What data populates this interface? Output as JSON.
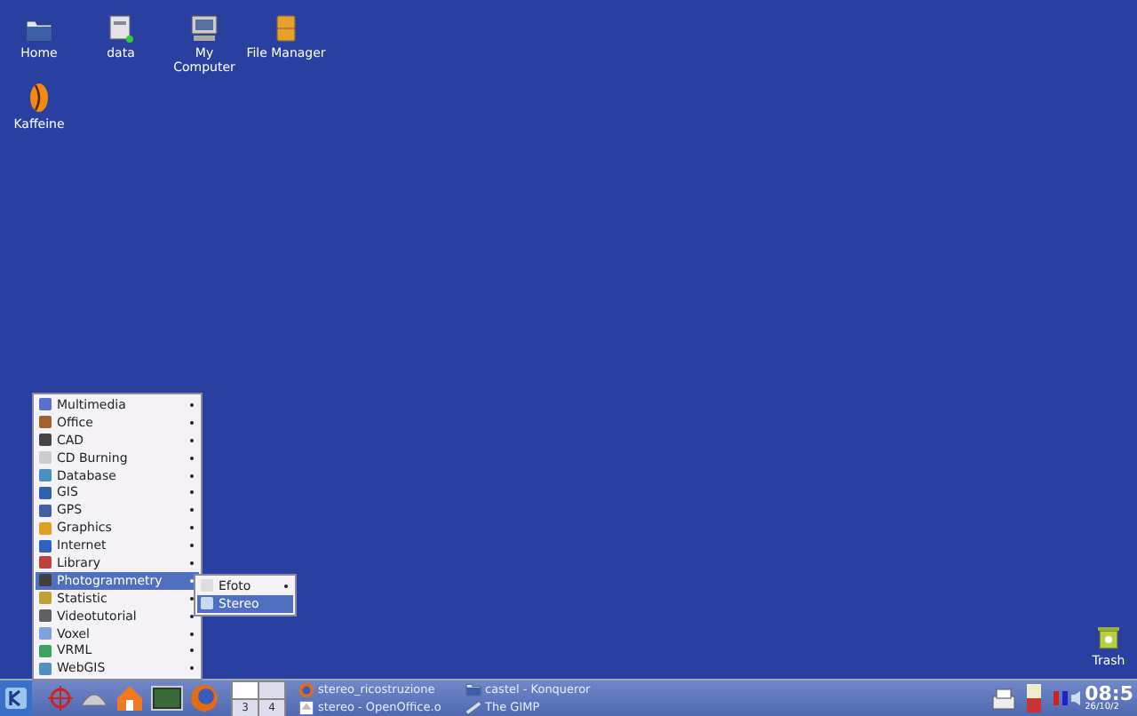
{
  "desktop_icons": [
    {
      "label": "Home",
      "kind": "folder"
    },
    {
      "label": "data",
      "kind": "drive"
    },
    {
      "label": "My Computer",
      "kind": "computer"
    },
    {
      "label": "File Manager",
      "kind": "cabinet"
    },
    {
      "label": "Kaffeine",
      "kind": "player"
    },
    {
      "label": "Trash",
      "kind": "trash"
    }
  ],
  "menu": {
    "items": [
      {
        "label": "Multimedia",
        "selected": false,
        "has_submenu": true
      },
      {
        "label": "Office",
        "selected": false,
        "has_submenu": true
      },
      {
        "label": "CAD",
        "selected": false,
        "has_submenu": true
      },
      {
        "label": "CD Burning",
        "selected": false,
        "has_submenu": true
      },
      {
        "label": "Database",
        "selected": false,
        "has_submenu": true
      },
      {
        "label": "GIS",
        "selected": false,
        "has_submenu": true
      },
      {
        "label": "GPS",
        "selected": false,
        "has_submenu": true
      },
      {
        "label": "Graphics",
        "selected": false,
        "has_submenu": true
      },
      {
        "label": "Internet",
        "selected": false,
        "has_submenu": true
      },
      {
        "label": "Library",
        "selected": false,
        "has_submenu": true
      },
      {
        "label": "Photogrammetry",
        "selected": true,
        "has_submenu": true
      },
      {
        "label": "Statistic",
        "selected": false,
        "has_submenu": true
      },
      {
        "label": "Videotutorial",
        "selected": false,
        "has_submenu": true
      },
      {
        "label": "Voxel",
        "selected": false,
        "has_submenu": true
      },
      {
        "label": "VRML",
        "selected": false,
        "has_submenu": true
      },
      {
        "label": "WebGIS",
        "selected": false,
        "has_submenu": true
      }
    ],
    "submenu": [
      {
        "label": "Efoto",
        "selected": false,
        "has_submenu": true
      },
      {
        "label": "Stereo",
        "selected": true,
        "has_submenu": false
      }
    ]
  },
  "taskbar": {
    "pager": [
      {
        "selected": true
      },
      {
        "selected": false
      },
      {
        "label": "3",
        "selected": false
      },
      {
        "label": "4",
        "selected": false
      }
    ],
    "tasks": [
      {
        "label": "stereo_ricostruzione",
        "kind": "browser"
      },
      {
        "label": "stereo - OpenOffice.o",
        "kind": "document"
      },
      {
        "label": "castel - Konqueror",
        "kind": "folder"
      },
      {
        "label": "The GIMP",
        "kind": "paint"
      }
    ],
    "clock": {
      "time": "08:5",
      "date": "26/10/2"
    }
  }
}
